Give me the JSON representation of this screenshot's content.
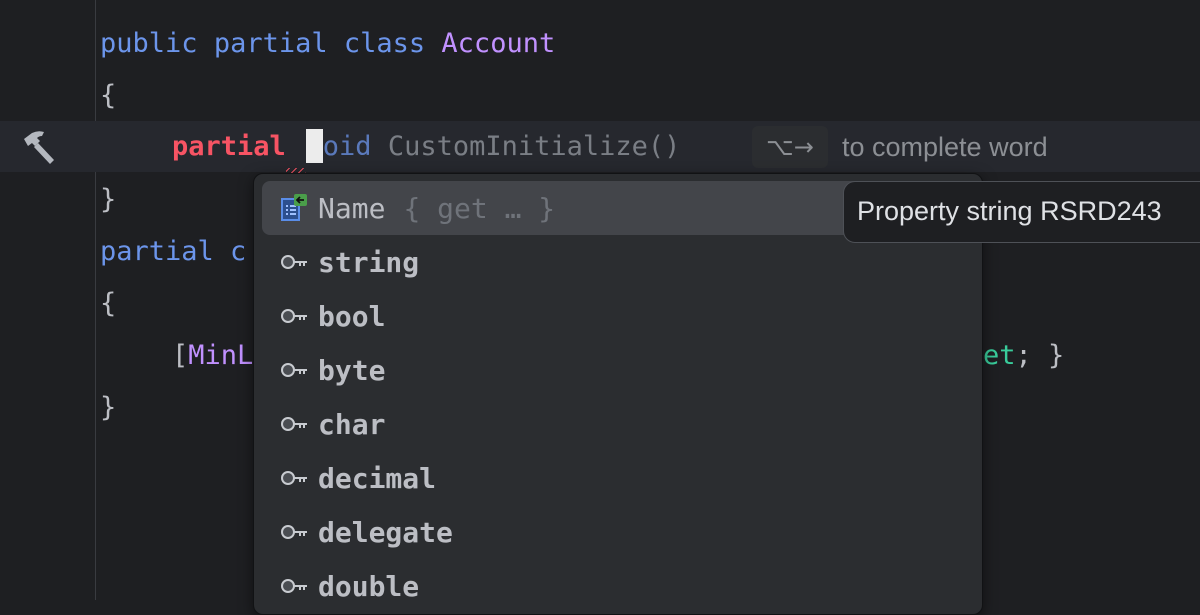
{
  "editor": {
    "lines": [
      {
        "parts": [
          "public",
          " ",
          "partial",
          " ",
          "class",
          " ",
          "Account"
        ]
      },
      {
        "text": "{"
      },
      {
        "keyword": "partial",
        "rest": "oid CustomInitialize()"
      },
      {
        "text": "}"
      },
      {
        "keyword": "partial",
        "rest": " c"
      },
      {
        "text": "{"
      },
      {
        "prefix": "[",
        "attr": "MinL",
        "suffix_green": "et",
        "suffix": "; }"
      },
      {
        "text": "}"
      }
    ],
    "gutter_icon": "hammer-icon"
  },
  "inline_hint": {
    "shortcut": "⌥→",
    "text": "to complete word"
  },
  "completion_popup": {
    "selected_index": 0,
    "items": [
      {
        "label": "Name",
        "tail": "{ get … }",
        "icon": "property-icon"
      },
      {
        "label": "string",
        "icon": "keyword-icon"
      },
      {
        "label": "bool",
        "icon": "keyword-icon"
      },
      {
        "label": "byte",
        "icon": "keyword-icon"
      },
      {
        "label": "char",
        "icon": "keyword-icon"
      },
      {
        "label": "decimal",
        "icon": "keyword-icon"
      },
      {
        "label": "delegate",
        "icon": "keyword-icon"
      },
      {
        "label": "double",
        "icon": "keyword-icon"
      }
    ]
  },
  "tooltip": {
    "text": "Property string RSRD243"
  },
  "colors": {
    "background": "#1e1f22",
    "keyword": "#6c95eb",
    "class_name": "#c191ff",
    "error_keyword": "#f75464",
    "green": "#39cc9b"
  }
}
